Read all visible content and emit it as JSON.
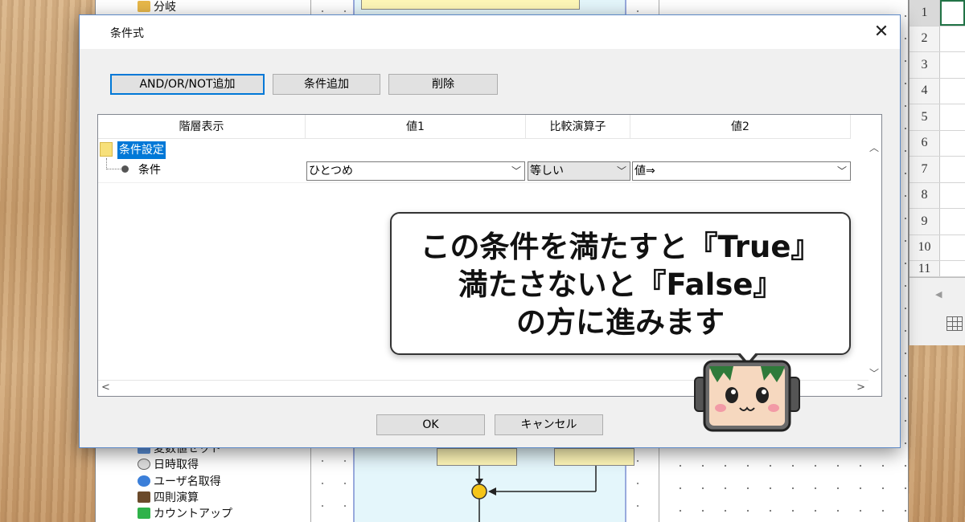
{
  "background_app": {
    "tree_items_top": [
      "分岐"
    ],
    "tree_items_bottom": [
      "変数値セット",
      "日時取得",
      "ユーザ名取得",
      "四則演算",
      "カウントアップ"
    ]
  },
  "excel": {
    "rows": [
      "1",
      "2",
      "3",
      "4",
      "5",
      "6",
      "7",
      "8",
      "9",
      "10",
      "11"
    ]
  },
  "dialog": {
    "title": "条件式",
    "close_label": "✕",
    "toolbar": {
      "and_or_not": "AND/OR/NOT追加",
      "add_condition": "条件追加",
      "delete": "削除"
    },
    "grid": {
      "columns": [
        "階層表示",
        "値1",
        "比較演算子",
        "値2"
      ],
      "root": "条件設定",
      "rows": [
        {
          "label": "条件",
          "value1": "ひとつめ",
          "operator": "等しい",
          "value2": "値⇒"
        }
      ]
    },
    "ok_label": "OK",
    "cancel_label": "キャンセル"
  },
  "bubble": {
    "lines": [
      "この条件を満たすと『True』",
      "満たさないと『False』",
      "の方に進みます"
    ]
  }
}
